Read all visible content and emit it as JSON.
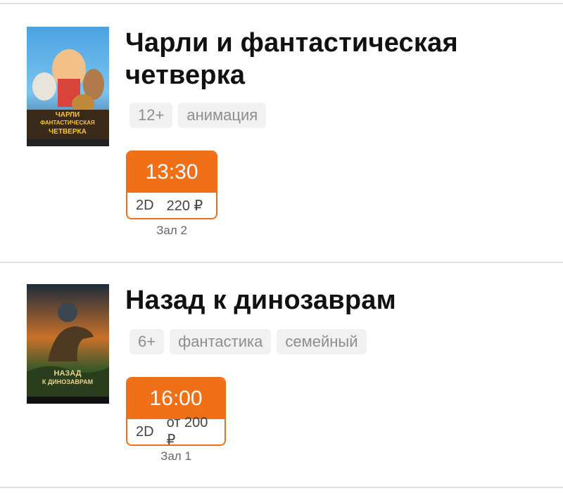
{
  "movies": [
    {
      "title_line1": "Чарли и фантастическая",
      "title_line2": "четверка",
      "poster_text_top": "ЧАРЛИ",
      "poster_text_mid": "ФАНТАСТИЧЕСКАЯ",
      "poster_text_bot": "ЧЕТВЕРКА",
      "tags": [
        "12+",
        "анимация"
      ],
      "session": {
        "time": "13:30",
        "format": "2D",
        "price": "220 ₽",
        "hall": "Зал 2"
      }
    },
    {
      "title_line1": "Назад к динозаврам",
      "poster_text_top": "НАЗАД",
      "poster_text_bot": "К ДИНОЗАВРАМ",
      "tags": [
        "6+",
        "фантастика",
        "семейный"
      ],
      "session": {
        "time": "16:00",
        "format": "2D",
        "price": "от 200 ₽",
        "hall": "Зал 1"
      }
    }
  ],
  "colors": {
    "accent": "#f07018",
    "divider": "#e3e3e3",
    "tag_bg": "#f1f1f1",
    "tag_text": "#8e8e8e"
  }
}
